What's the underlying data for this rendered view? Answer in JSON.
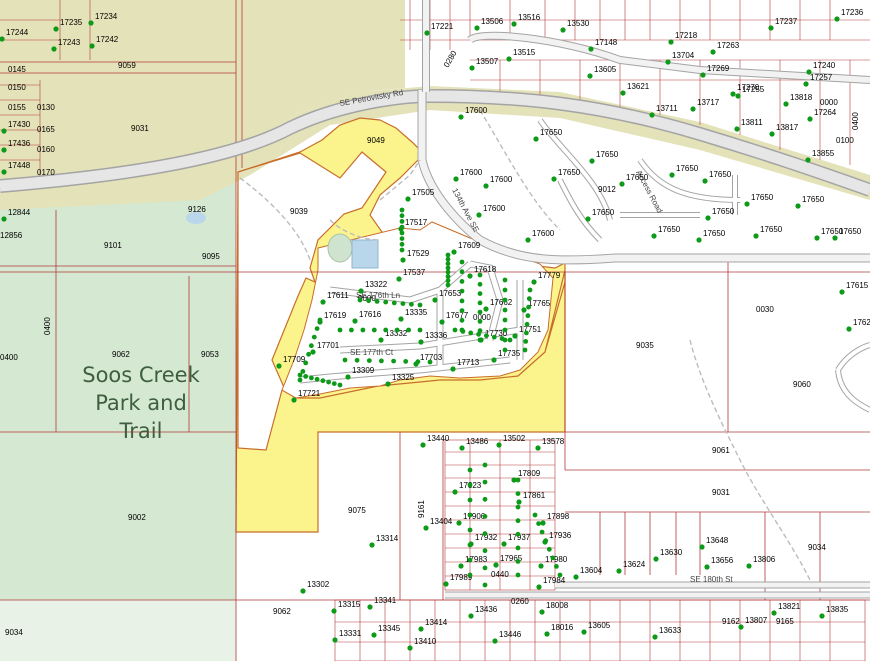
{
  "map": {
    "park_label_lines": [
      "Soos Creek",
      "Park and",
      "Trail"
    ],
    "colors": {
      "park": "#d4e8d2",
      "open_space": "#e4e2b8",
      "highlight": "#fbf38c",
      "highlight_border": "#c86e2a",
      "road_fill": "#e6e6e6",
      "road_edge": "#a4a4a4",
      "parcel_line": "#b23a3a",
      "marker": "#0c9a18",
      "water": "#b9d6ea"
    },
    "roads": [
      {
        "id": "petrovitsky",
        "label": "SE Petrovitsky Rd"
      },
      {
        "id": "ave-134",
        "label": "134th Ave SE"
      },
      {
        "id": "se-176th-ln",
        "label": "SE 176th Ln"
      },
      {
        "id": "se-177th-ct",
        "label": "SE 177th Ct"
      },
      {
        "id": "se-180th-st",
        "label": "SE 180th St"
      },
      {
        "id": "access-road",
        "label": "Access Road"
      }
    ],
    "parcels": [
      {
        "id": "9039",
        "label": "9039"
      },
      {
        "id": "9049",
        "label": "9049"
      },
      {
        "id": "9031-w",
        "label": "9031"
      },
      {
        "id": "9059",
        "label": "9059"
      },
      {
        "id": "9126",
        "label": "9126"
      },
      {
        "id": "9101",
        "label": "9101"
      },
      {
        "id": "9095",
        "label": "9095"
      },
      {
        "id": "9062-w",
        "label": "9062"
      },
      {
        "id": "9053",
        "label": "9053"
      },
      {
        "id": "0400-a",
        "label": "0400"
      },
      {
        "id": "0400-b",
        "label": "0400"
      },
      {
        "id": "9002",
        "label": "9002"
      },
      {
        "id": "9034-w",
        "label": "9034"
      },
      {
        "id": "9062-s",
        "label": "9062"
      },
      {
        "id": "9075",
        "label": "9075"
      },
      {
        "id": "9161",
        "label": "9161"
      },
      {
        "id": "9035",
        "label": "9035"
      },
      {
        "id": "9060",
        "label": "9060"
      },
      {
        "id": "0030",
        "label": "0030"
      },
      {
        "id": "9061",
        "label": "9061"
      },
      {
        "id": "9031-e",
        "label": "9031"
      },
      {
        "id": "9034-e",
        "label": "9034"
      },
      {
        "id": "9012",
        "label": "9012"
      },
      {
        "id": "0440",
        "label": "0440"
      },
      {
        "id": "0260",
        "label": "0260"
      },
      {
        "id": "9162",
        "label": "9162"
      },
      {
        "id": "9165",
        "label": "9165"
      },
      {
        "id": "0000-a",
        "label": "0000"
      },
      {
        "id": "0000-b",
        "label": "0000"
      },
      {
        "id": "0280",
        "label": "0280"
      }
    ],
    "addresses": [
      "17600",
      "17600",
      "17600",
      "17600",
      "17600",
      "17650",
      "17650",
      "17650",
      "17650",
      "17650",
      "17650",
      "17650",
      "17650",
      "17650",
      "17650",
      "17650",
      "17650",
      "17650",
      "17650",
      "17650",
      "17505",
      "17517",
      "17529",
      "17537",
      "17609",
      "17618",
      "17653",
      "17677",
      "17662",
      "17765",
      "17779",
      "17751",
      "17730",
      "17735",
      "17713",
      "17703",
      "17709",
      "17721",
      "17701",
      "17619",
      "17616",
      "17611",
      "13322",
      "13335",
      "13332",
      "13336",
      "13309",
      "13325",
      "13440",
      "13486",
      "13502",
      "13578",
      "17809",
      "17823",
      "17861",
      "17898",
      "17906",
      "17932",
      "17937",
      "17936",
      "17965",
      "17980",
      "17983",
      "17984",
      "17989",
      "13404",
      "13314",
      "13302",
      "13604",
      "13624",
      "13630",
      "13648",
      "13656",
      "13806",
      "13821",
      "13835",
      "13807",
      "13605",
      "13633",
      "13446",
      "13436",
      "13414",
      "13410",
      "13345",
      "13341",
      "13331",
      "13315",
      "18008",
      "18016",
      "13506",
      "13516",
      "13530",
      "13515",
      "13507",
      "13605",
      "13621",
      "13704",
      "13717",
      "13711",
      "13811",
      "13817",
      "13818",
      "13855",
      "17221",
      "17148",
      "17218",
      "17263",
      "17237",
      "17240",
      "17264",
      "17257",
      "17270",
      "17269",
      "17255",
      "17236",
      "17234",
      "17235",
      "17243",
      "17242",
      "17244",
      "17430",
      "17436",
      "17448",
      "12844",
      "12856",
      "17615",
      "17627"
    ],
    "edge_labels": [
      "0145",
      "0150",
      "0155",
      "0160",
      "0165",
      "0170",
      "0130",
      "0400",
      "0000",
      "0100"
    ]
  }
}
